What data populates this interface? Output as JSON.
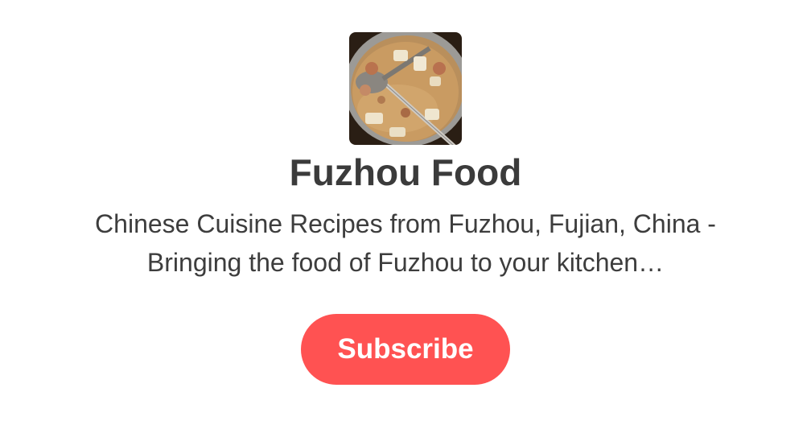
{
  "publication": {
    "logo_icon": "hotpot-food-photo-icon",
    "title": "Fuzhou Food",
    "description": "Chinese Cuisine Recipes from Fuzhou, Fujian, China - Bringing the food of Fuzhou to your kitchen…"
  },
  "subscribe_button": {
    "label": "Subscribe"
  },
  "colors": {
    "accent": "#ff5252",
    "text": "#3d3d3d",
    "background": "#ffffff"
  }
}
